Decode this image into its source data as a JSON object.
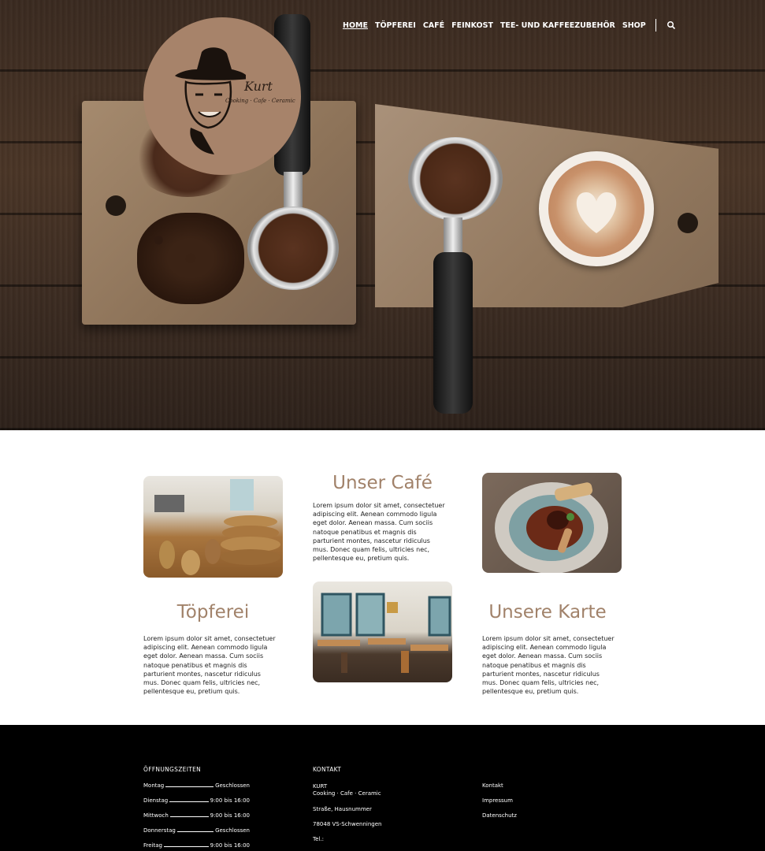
{
  "nav": {
    "items": [
      {
        "label": "HOME"
      },
      {
        "label": "TÖPFEREI"
      },
      {
        "label": "CAFÉ"
      },
      {
        "label": "FEINKOST"
      },
      {
        "label": "TEE- UND KAFFEEZUBEHÖR"
      },
      {
        "label": "SHOP"
      }
    ],
    "search_icon": "search-icon"
  },
  "logo": {
    "name": "Kurt",
    "tagline": "Cooking · Cafe · Ceramic"
  },
  "sections": {
    "cafe": {
      "heading": "Unser Café",
      "text": "Lorem ipsum dolor sit amet, consectetuer adipiscing elit. Aenean commodo ligula eget dolor. Aenean massa. Cum sociis natoque penatibus et magnis dis parturient montes, nascetur ridiculus mus. Donec quam felis, ultricies nec, pellentesque eu, pretium quis."
    },
    "toepferei": {
      "heading": "Töpferei",
      "text": "Lorem ipsum dolor sit amet, consectetuer adipiscing elit. Aenean commodo ligula eget dolor. Aenean massa. Cum sociis natoque penatibus et magnis dis parturient montes, nascetur ridiculus mus. Donec quam felis, ultricies nec, pellentesque eu, pretium quis."
    },
    "karte": {
      "heading": "Unsere Karte",
      "text": "Lorem ipsum dolor sit amet, consectetuer adipiscing elit. Aenean commodo ligula eget dolor. Aenean massa. Cum sociis natoque penatibus et magnis dis parturient montes, nascetur ridiculus mus. Donec quam felis, ultricies nec, pellentesque eu, pretium quis."
    }
  },
  "footer": {
    "hours_title": "ÖFFNUNGSZEITEN",
    "hours": [
      {
        "day": "Montag",
        "time": "Geschlossen"
      },
      {
        "day": "Dienstag",
        "time": "9:00 bis 16:00"
      },
      {
        "day": "Mittwoch",
        "time": "9:00 bis 16:00"
      },
      {
        "day": "Donnerstag",
        "time": "Geschlossen"
      },
      {
        "day": "Freitag",
        "time": "9:00 bis 16:00"
      }
    ],
    "contact_title": "KONTAKT",
    "contact": {
      "name": "KURT",
      "tagline": "Cooking · Cafe · Ceramic",
      "street": "Straße, Hausnummer",
      "city": "78048 VS-Schwenningen",
      "tel": "Tel.:"
    },
    "links": [
      {
        "label": "Kontakt"
      },
      {
        "label": "Impressum"
      },
      {
        "label": "Datenschutz"
      }
    ]
  }
}
